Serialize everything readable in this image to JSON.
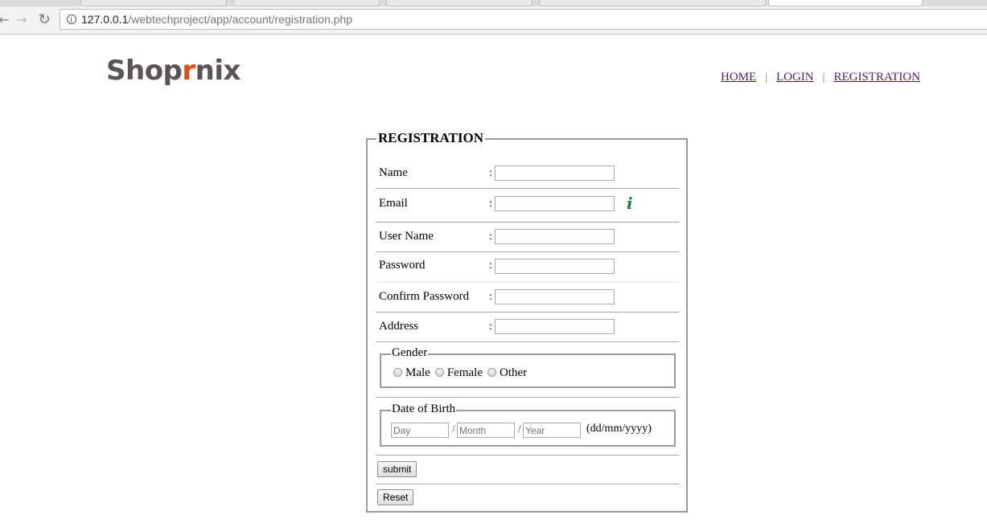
{
  "browser": {
    "url_host": "127.0.0.1",
    "url_path": "/webtechproject/app/account/registration.php",
    "back_glyph": "←",
    "forward_glyph": "→",
    "reload_glyph": "↻"
  },
  "header": {
    "logo_text_1": "Shop",
    "logo_text_cart": "r",
    "logo_text_2": "nix",
    "nav": {
      "home": "HOME",
      "login": "LOGIN",
      "registration": "REGISTRATION",
      "separator": "|"
    }
  },
  "form": {
    "legend": "REGISTRATION",
    "colon": ":",
    "fields": {
      "name": "Name",
      "email": "Email",
      "username": "User Name",
      "password": "Password",
      "confirm_password": "Confirm Password",
      "address": "Address"
    },
    "email_hint_icon": "i",
    "gender": {
      "legend": "Gender",
      "options": [
        "Male",
        "Female",
        "Other"
      ]
    },
    "dob": {
      "legend": "Date of Birth",
      "day_placeholder": "Day",
      "month_placeholder": "Month",
      "year_placeholder": "Year",
      "separator": "/",
      "format_hint": "(dd/mm/yyyy)"
    },
    "submit_label": "submit",
    "reset_label": "Reset"
  },
  "colors": {
    "logo_dark": "#5b5356",
    "logo_accent": "#e24d12",
    "nav_link": "#4b1a7a",
    "hint_icon": "#1d7c3a"
  }
}
